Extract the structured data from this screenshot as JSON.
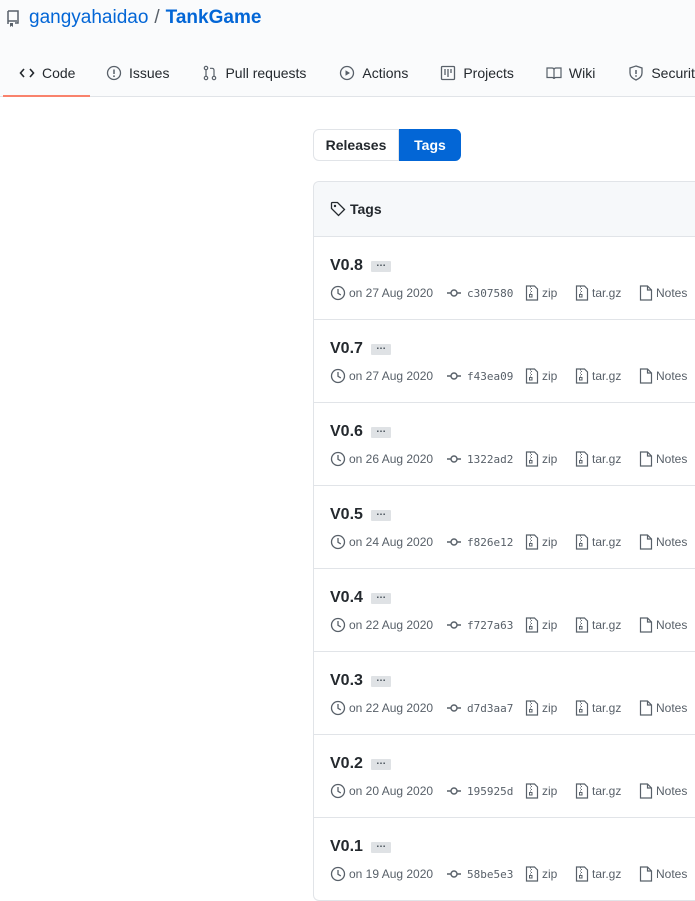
{
  "repo": {
    "owner": "gangyahaidao",
    "separator": "/",
    "name": "TankGame"
  },
  "nav": {
    "code": "Code",
    "issues": "Issues",
    "pull_requests": "Pull requests",
    "actions": "Actions",
    "projects": "Projects",
    "wiki": "Wiki",
    "security": "Security"
  },
  "toggle": {
    "releases": "Releases",
    "tags": "Tags"
  },
  "box": {
    "header": "Tags"
  },
  "tags": [
    {
      "name": "V0.8",
      "date": "on 27 Aug 2020",
      "sha": "c307580",
      "zip": "zip",
      "targz": "tar.gz",
      "notes": "Notes"
    },
    {
      "name": "V0.7",
      "date": "on 27 Aug 2020",
      "sha": "f43ea09",
      "zip": "zip",
      "targz": "tar.gz",
      "notes": "Notes"
    },
    {
      "name": "V0.6",
      "date": "on 26 Aug 2020",
      "sha": "1322ad2",
      "zip": "zip",
      "targz": "tar.gz",
      "notes": "Notes"
    },
    {
      "name": "V0.5",
      "date": "on 24 Aug 2020",
      "sha": "f826e12",
      "zip": "zip",
      "targz": "tar.gz",
      "notes": "Notes"
    },
    {
      "name": "V0.4",
      "date": "on 22 Aug 2020",
      "sha": "f727a63",
      "zip": "zip",
      "targz": "tar.gz",
      "notes": "Notes"
    },
    {
      "name": "V0.3",
      "date": "on 22 Aug 2020",
      "sha": "d7d3aa7",
      "zip": "zip",
      "targz": "tar.gz",
      "notes": "Notes"
    },
    {
      "name": "V0.2",
      "date": "on 20 Aug 2020",
      "sha": "195925d",
      "zip": "zip",
      "targz": "tar.gz",
      "notes": "Notes"
    },
    {
      "name": "V0.1",
      "date": "on 19 Aug 2020",
      "sha": "58be5e3",
      "zip": "zip",
      "targz": "tar.gz",
      "notes": "Notes"
    }
  ],
  "ellipsis_label": "…",
  "colors": {
    "link": "#0366d6",
    "active_tab_underline": "#f9826c",
    "selected_toggle": "#0366d6"
  }
}
